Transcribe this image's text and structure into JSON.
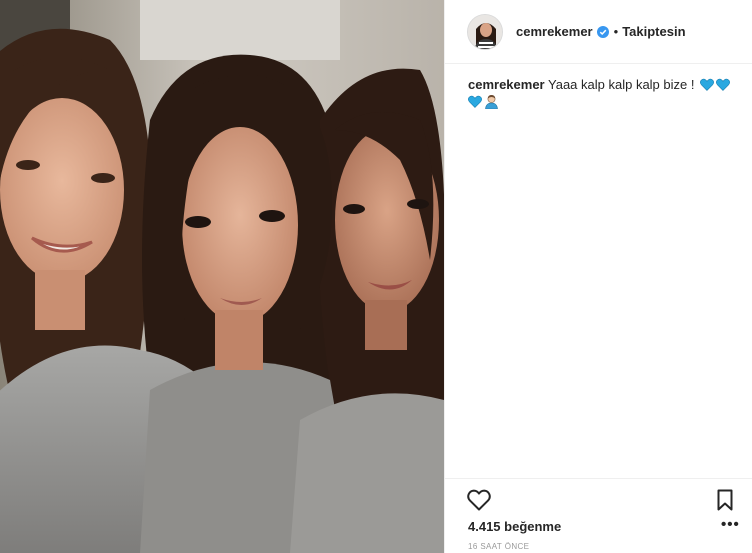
{
  "post": {
    "username": "cemrekemer",
    "follow_status": "Takiptesin",
    "separator": "•",
    "caption_user": "cemrekemer",
    "caption_text": "Yaaa kalp kalp kalp bize !",
    "caption_emojis": [
      "blue-heart",
      "blue-heart",
      "blue-heart",
      "person-emoji"
    ],
    "likes": "4.415 beğenme",
    "time": "16 SAAT ÖNCE",
    "more_label": "•••"
  },
  "colors": {
    "verified": "#3897f0",
    "emoji_heart": "#2aa8e0",
    "time": "#999999"
  }
}
